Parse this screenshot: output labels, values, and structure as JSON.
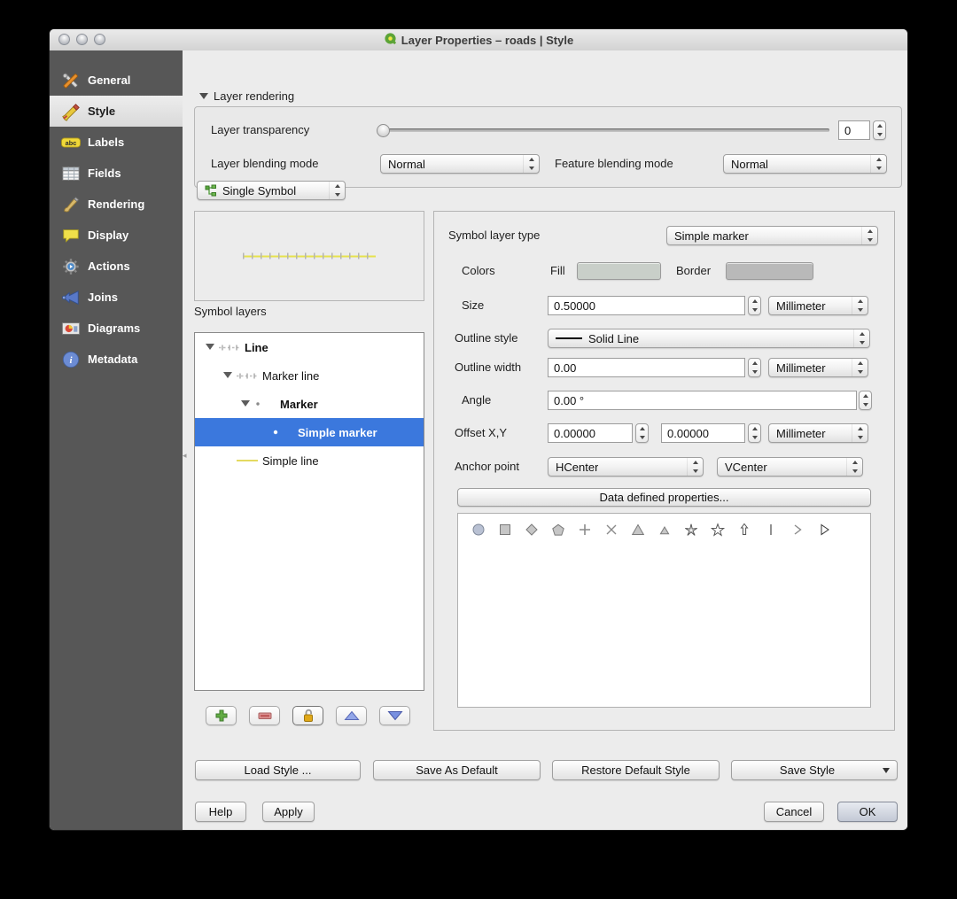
{
  "window": {
    "title": "Layer Properties – roads | Style"
  },
  "sidebar": {
    "items": [
      {
        "label": "General",
        "icon": "tools",
        "selected": false
      },
      {
        "label": "Style",
        "icon": "style-brush",
        "selected": true
      },
      {
        "label": "Labels",
        "icon": "labels-abc",
        "selected": false
      },
      {
        "label": "Fields",
        "icon": "fields-table",
        "selected": false
      },
      {
        "label": "Rendering",
        "icon": "render-brush",
        "selected": false
      },
      {
        "label": "Display",
        "icon": "display-bubble",
        "selected": false
      },
      {
        "label": "Actions",
        "icon": "actions-gear",
        "selected": false
      },
      {
        "label": "Joins",
        "icon": "joins-arrow",
        "selected": false
      },
      {
        "label": "Diagrams",
        "icon": "diagrams-chart",
        "selected": false
      },
      {
        "label": "Metadata",
        "icon": "metadata-info",
        "selected": false
      }
    ]
  },
  "rendering": {
    "header": "Layer rendering",
    "transparency_label": "Layer transparency",
    "transparency_value": "0",
    "layer_blend_label": "Layer blending mode",
    "layer_blend_value": "Normal",
    "feature_blend_label": "Feature blending mode",
    "feature_blend_value": "Normal"
  },
  "symbol": {
    "renderer": "Single Symbol",
    "symbol_layers_label": "Symbol layers",
    "preview_line_color": "#e6e24e",
    "preview_tick_color": "#b4b4b4",
    "tree": [
      {
        "label": "Line",
        "level": 0,
        "bold": true,
        "expander": true,
        "icon": "marker-line",
        "selected": false
      },
      {
        "label": "Marker line",
        "level": 1,
        "bold": false,
        "expander": true,
        "icon": "marker-line",
        "selected": false
      },
      {
        "label": "Marker",
        "level": 2,
        "bold": true,
        "expander": true,
        "icon": "dot",
        "selected": false
      },
      {
        "label": "Simple marker",
        "level": 3,
        "bold": false,
        "expander": false,
        "icon": "dot",
        "selected": true
      },
      {
        "label": "Simple line",
        "level": 1,
        "bold": false,
        "expander": false,
        "icon": "yellow-line",
        "selected": false
      }
    ],
    "selection_color": "#3b78dd",
    "layer_buttons": [
      {
        "name": "add-symbol-layer",
        "icon": "plus-green"
      },
      {
        "name": "remove-symbol-layer",
        "icon": "minus-red"
      },
      {
        "name": "lock-color",
        "icon": "lock-gold",
        "focused": true
      },
      {
        "name": "move-layer-up",
        "icon": "triangle-up-blue"
      },
      {
        "name": "move-layer-down",
        "icon": "triangle-down-blue"
      }
    ]
  },
  "properties": {
    "symbol_layer_type_label": "Symbol layer type",
    "symbol_layer_type_value": "Simple marker",
    "colors_label": "Colors",
    "fill_label": "Fill",
    "fill_color": "#c9cfc9",
    "border_label": "Border",
    "border_color": "#b9b9b9",
    "size_label": "Size",
    "size_value": "0.50000",
    "size_unit": "Millimeter",
    "outline_style_label": "Outline style",
    "outline_style_value": "Solid Line",
    "outline_width_label": "Outline width",
    "outline_width_value": "0.00",
    "outline_width_unit": "Millimeter",
    "angle_label": "Angle",
    "angle_value": "0.00 °",
    "offset_label": "Offset X,Y",
    "offset_x_value": "0.00000",
    "offset_y_value": "0.00000",
    "offset_unit": "Millimeter",
    "anchor_label": "Anchor point",
    "anchor_h_value": "HCenter",
    "anchor_v_value": "VCenter",
    "data_defined_button": "Data defined properties...",
    "marker_shapes": [
      "circle",
      "square",
      "diamond",
      "pentagon",
      "cross-plus",
      "cross-x",
      "triangle",
      "equilateral-triangle",
      "star-concave",
      "star",
      "arrow-up",
      "line-vertical",
      "chevron-right",
      "arrowhead-right"
    ]
  },
  "footer": {
    "load_style": "Load Style ...",
    "save_as_default": "Save As Default",
    "restore_default": "Restore Default Style",
    "save_style": "Save Style",
    "help": "Help",
    "apply": "Apply",
    "cancel": "Cancel",
    "ok": "OK"
  }
}
